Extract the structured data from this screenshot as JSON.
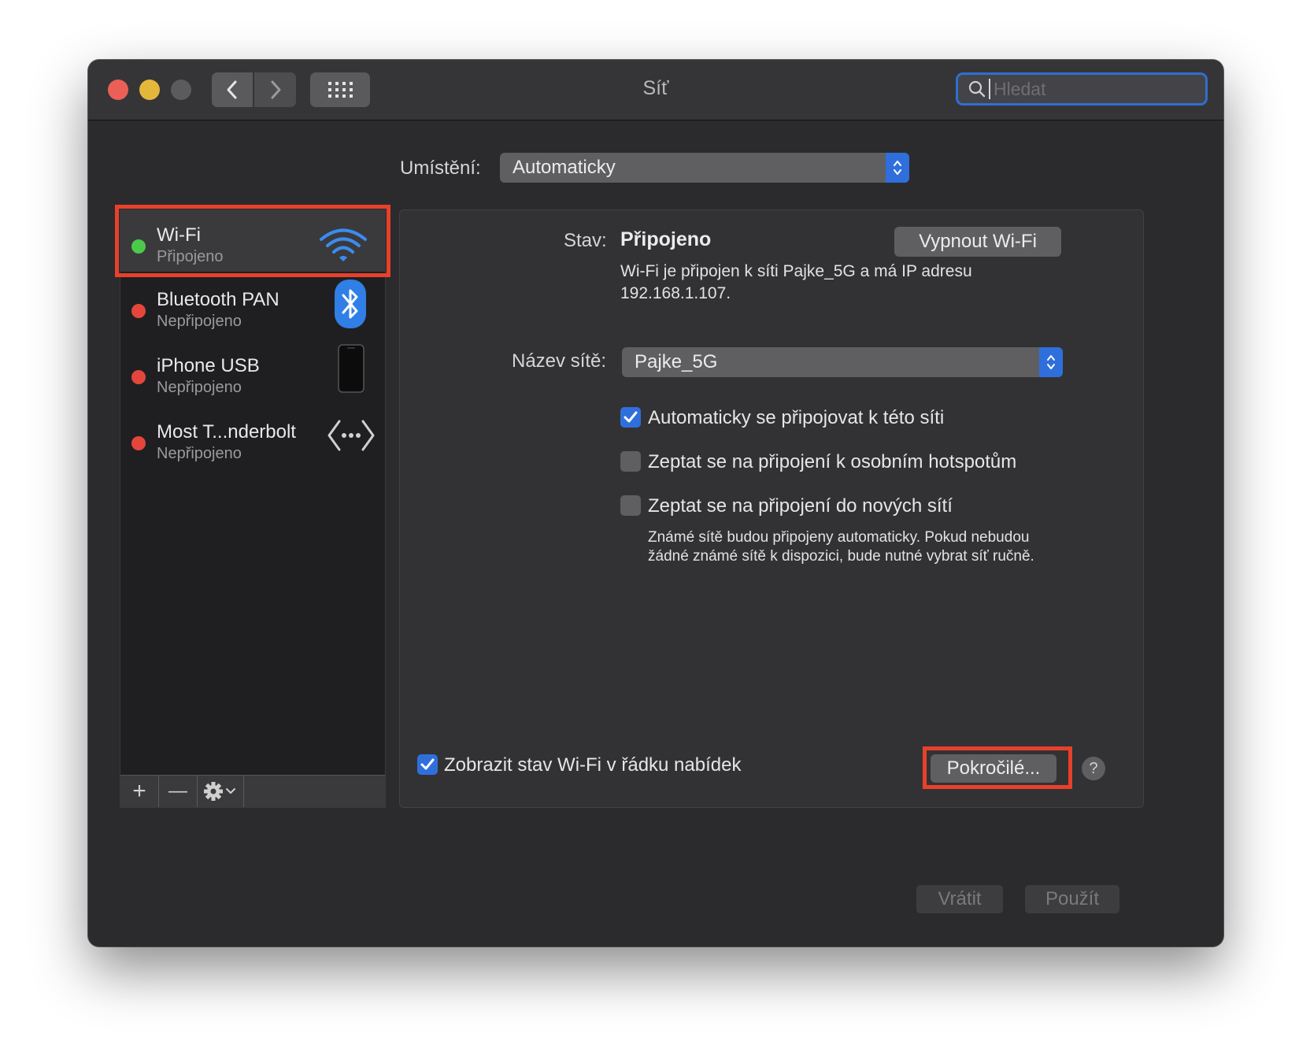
{
  "window": {
    "title": "Síť",
    "search_placeholder": "Hledat"
  },
  "location": {
    "label": "Umístění:",
    "value": "Automaticky"
  },
  "sidebar": {
    "items": [
      {
        "name": "Wi-Fi",
        "status": "Připojeno",
        "status_color": "#4cc84a",
        "icon": "wifi-icon"
      },
      {
        "name": "Bluetooth PAN",
        "status": "Nepřipojeno",
        "status_color": "#e5463c",
        "icon": "bluetooth-icon"
      },
      {
        "name": "iPhone USB",
        "status": "Nepřipojeno",
        "status_color": "#e5463c",
        "icon": "iphone-icon"
      },
      {
        "name": "Most T...nderbolt",
        "status": "Nepřipojeno",
        "status_color": "#e5463c",
        "icon": "thunderbolt-bridge-icon"
      }
    ],
    "footer": {
      "add": "+",
      "remove": "—",
      "action_icon": "gear-icon"
    }
  },
  "detail": {
    "status_label": "Stav:",
    "status_value": "Připojeno",
    "turn_off_button": "Vypnout Wi-Fi",
    "status_desc_line1": "Wi-Fi je připojen k síti Pajke_5G a má IP adresu",
    "status_desc_line2": "192.168.1.107.",
    "network_label": "Název sítě:",
    "network_value": "Pajke_5G",
    "checkboxes": [
      {
        "label": "Automaticky se připojovat k této síti",
        "checked": true
      },
      {
        "label": "Zeptat se na připojení k osobním hotspotům",
        "checked": false
      },
      {
        "label": "Zeptat se na připojení do nových sítí",
        "checked": false
      }
    ],
    "hint_line1": "Známé sítě budou připojeny automaticky. Pokud nebudou",
    "hint_line2": "žádné známé sítě k dispozici, bude nutné vybrat síť ručně.",
    "show_status_label": "Zobrazit stav Wi-Fi v řádku nabídek",
    "show_status_checked": true,
    "advanced_button": "Pokročilé...",
    "help": "?"
  },
  "footer": {
    "revert": "Vrátit",
    "apply": "Použít"
  },
  "colors": {
    "accent": "#2f6fdc",
    "highlight": "#e8402a"
  }
}
